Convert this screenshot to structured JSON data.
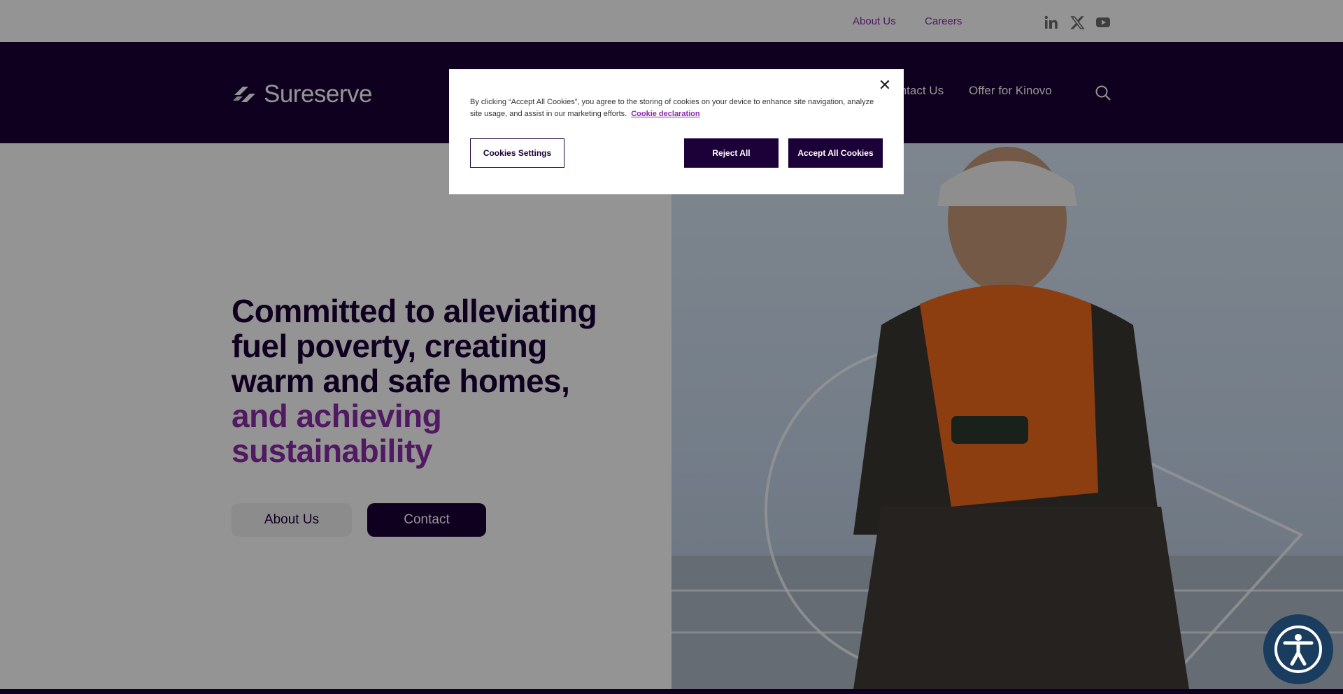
{
  "utility": {
    "about_label": "About Us",
    "careers_label": "Careers",
    "social_icons": [
      "linkedin-icon",
      "x-icon",
      "youtube-icon"
    ]
  },
  "nav": {
    "logo_text": "Sureserve",
    "items": [
      {
        "label": "Contact Us"
      },
      {
        "label": "Offer for Kinovo"
      }
    ]
  },
  "hero": {
    "title_main": "Committed to alleviating fuel poverty, creating warm and safe homes,",
    "title_accent": "and achieving sustainability",
    "about_button": "About Us",
    "contact_button": "Contact"
  },
  "cookie": {
    "text": "By clicking “Accept All Cookies”, you agree to the storing of cookies on your device to enhance site navigation, analyze site usage, and assist in our marketing efforts.",
    "link_label": "Cookie declaration",
    "settings_label": "Cookies Settings",
    "reject_label": "Reject All",
    "accept_label": "Accept All Cookies",
    "close_symbol": "✕"
  },
  "colors": {
    "brand_dark": "#1c0038",
    "brand_accent": "#8a2ba8"
  }
}
